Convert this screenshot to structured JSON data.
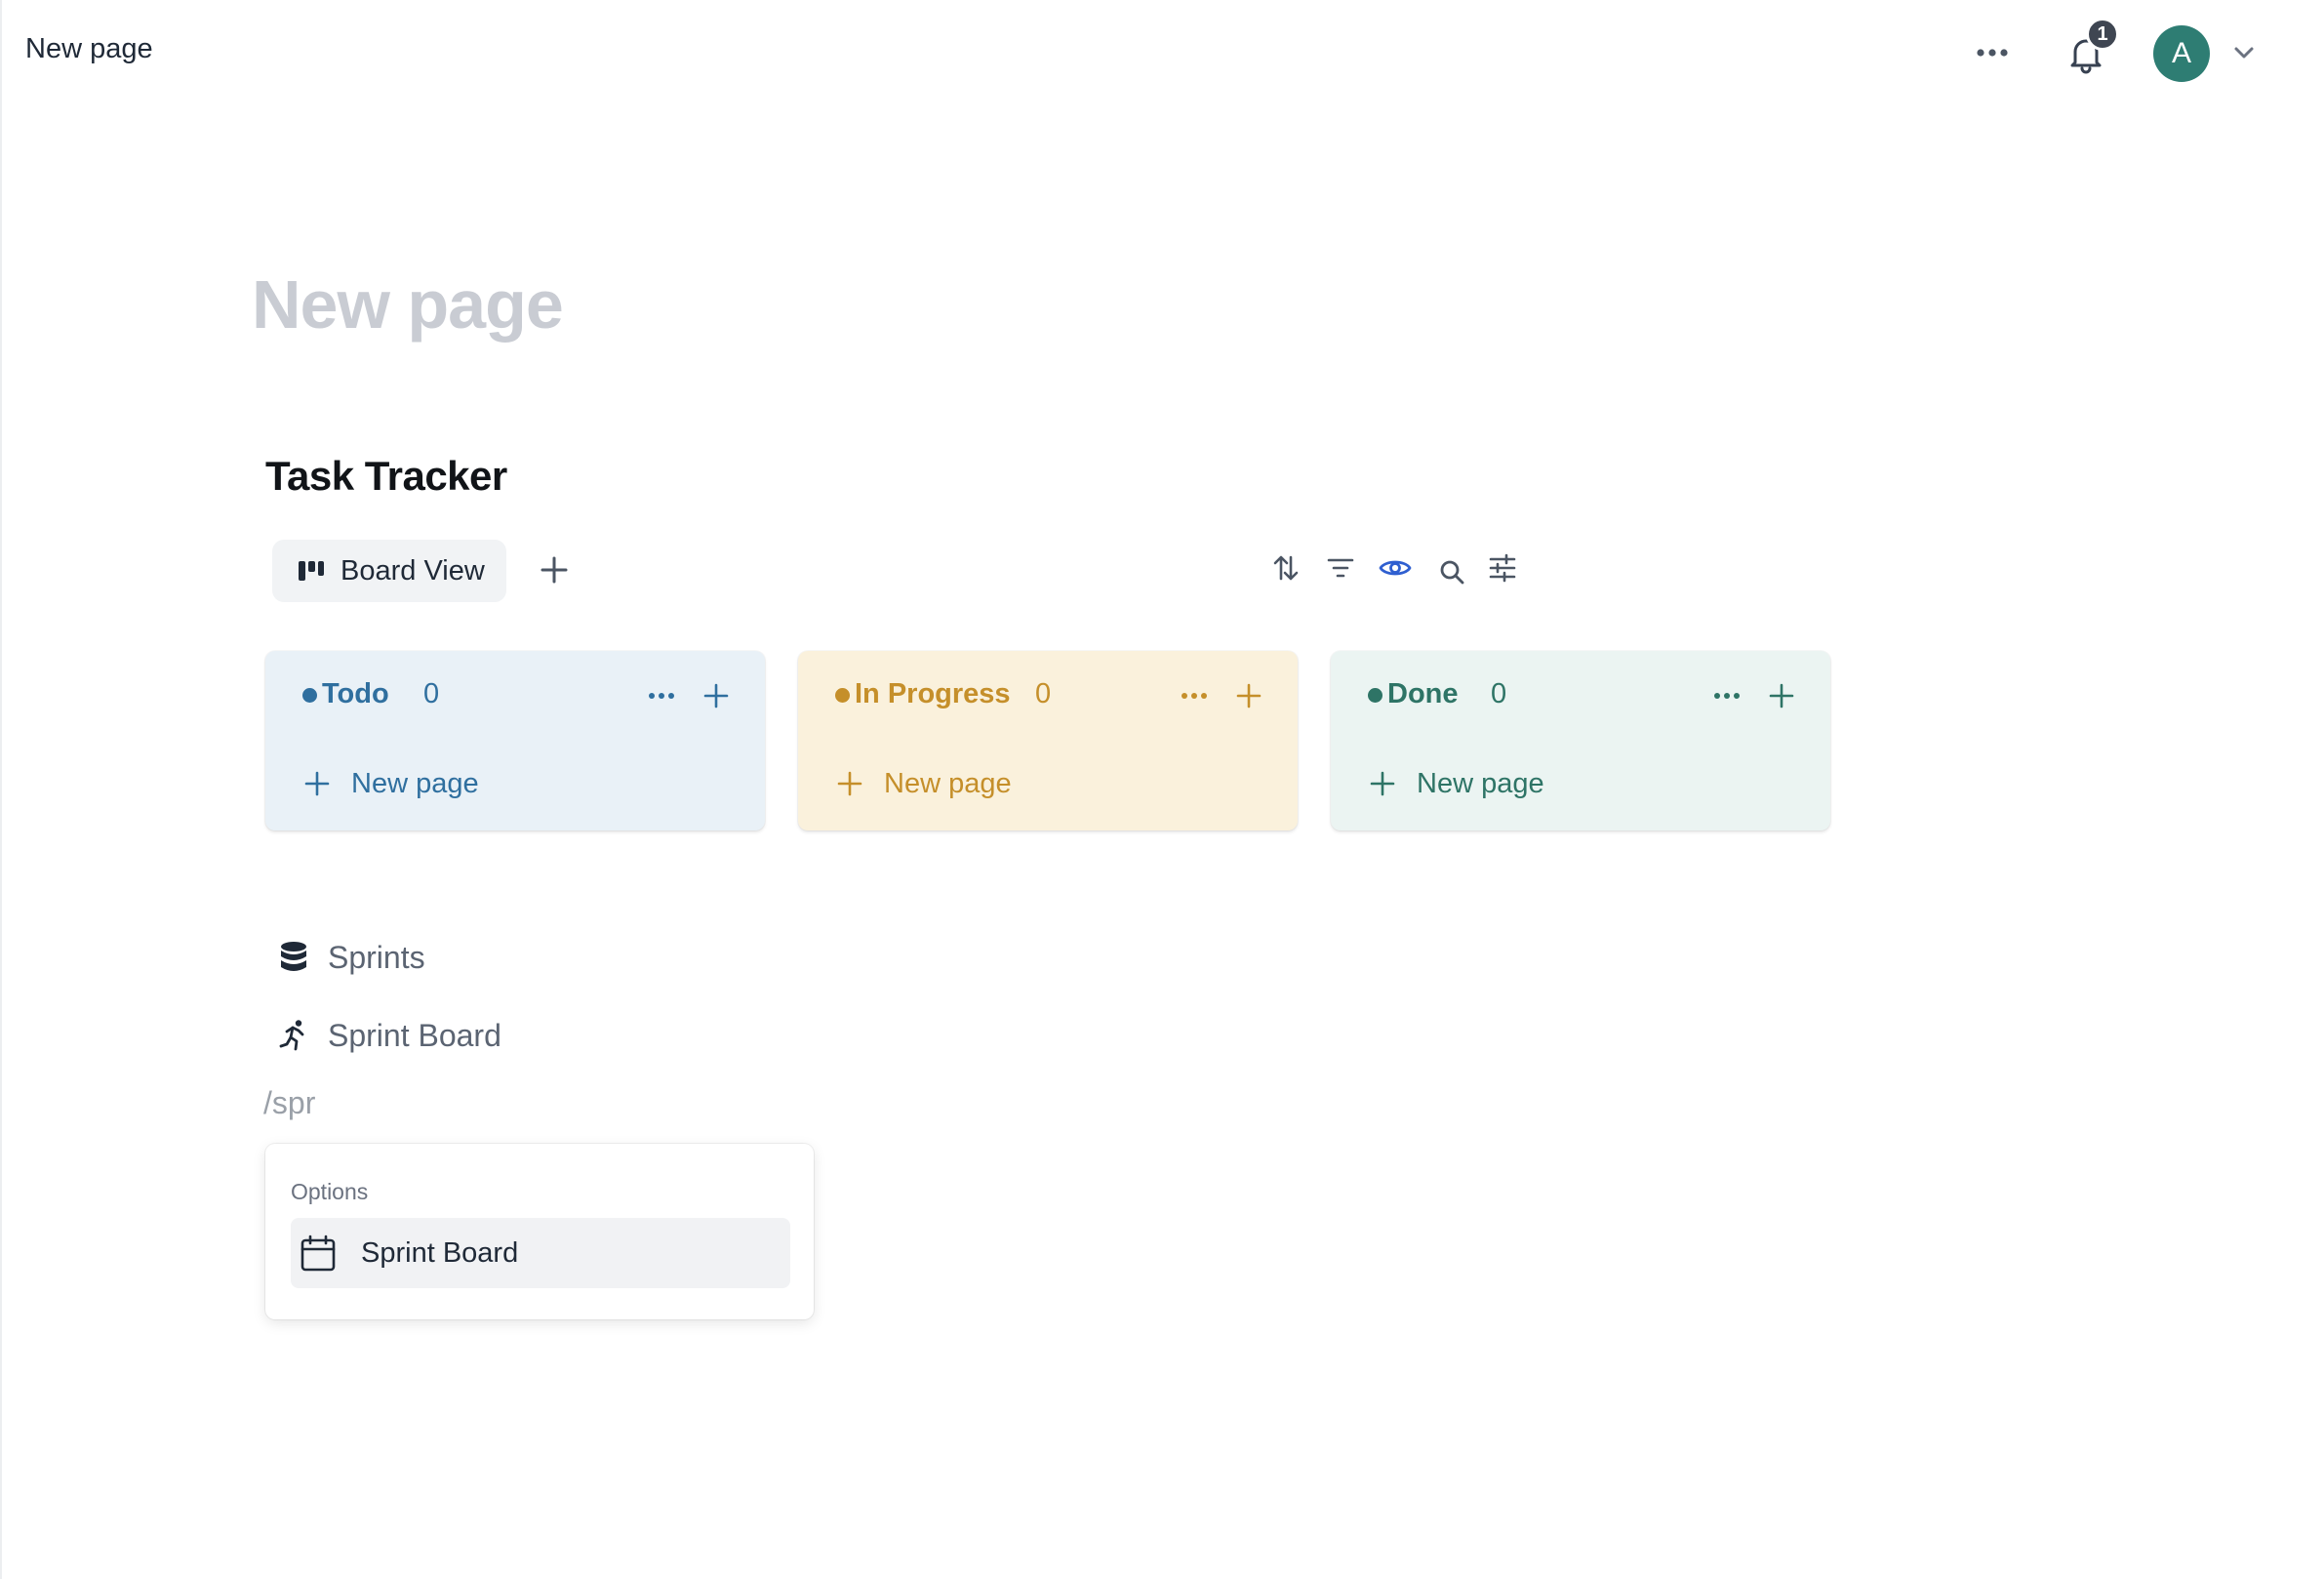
{
  "topbar": {
    "breadcrumb": "New page",
    "notification_count": "1",
    "avatar_initial": "A"
  },
  "page": {
    "title": "New page"
  },
  "database": {
    "title": "Task Tracker",
    "view_tab_label": "Board View",
    "columns": [
      {
        "name": "Todo",
        "count": "0",
        "new_label": "New page",
        "color": "#2f6f9f",
        "bg": "#e9f1f7"
      },
      {
        "name": "In Progress",
        "count": "0",
        "new_label": "New page",
        "color": "#c58f2a",
        "bg": "#faf1dc"
      },
      {
        "name": "Done",
        "count": "0",
        "new_label": "New page",
        "color": "#2e7466",
        "bg": "#ebf4f2"
      }
    ]
  },
  "linked_pages": [
    {
      "label": "Sprints",
      "icon": "database-icon"
    },
    {
      "label": "Sprint Board",
      "icon": "running-icon"
    }
  ],
  "slash_command": "/spr",
  "popup": {
    "section_label": "Options",
    "items": [
      {
        "label": "Sprint Board",
        "icon": "calendar-icon"
      }
    ]
  },
  "colors": {
    "accent_eye": "#2f5fd0",
    "avatar_bg": "#2e7d73"
  }
}
